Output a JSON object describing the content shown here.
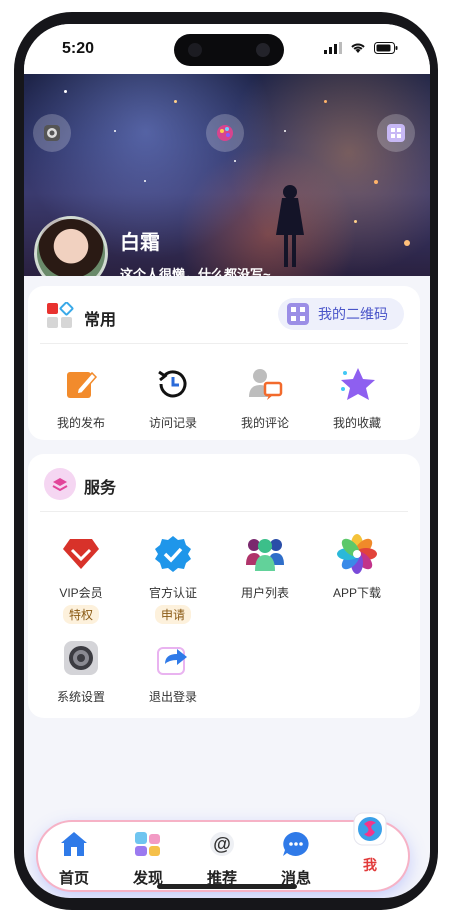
{
  "status_bar": {
    "time": "5:20"
  },
  "profile": {
    "name": "白霜",
    "bio": "这个人很懒，什么都没写~"
  },
  "common": {
    "title": "常用",
    "qr_label": "我的二维码",
    "items": [
      {
        "label": "我的发布",
        "icon": "edit-icon"
      },
      {
        "label": "访问记录",
        "icon": "history-icon"
      },
      {
        "label": "我的评论",
        "icon": "comment-icon"
      },
      {
        "label": "我的收藏",
        "icon": "star-icon"
      }
    ]
  },
  "service": {
    "title": "服务",
    "items": [
      {
        "label": "VIP会员",
        "tag": "特权",
        "icon": "vip-icon"
      },
      {
        "label": "官方认证",
        "tag": "申请",
        "icon": "verified-icon"
      },
      {
        "label": "用户列表",
        "icon": "users-icon"
      },
      {
        "label": "APP下载",
        "icon": "app-download-icon"
      },
      {
        "label": "系统设置",
        "icon": "settings-icon"
      },
      {
        "label": "退出登录",
        "icon": "logout-icon"
      }
    ]
  },
  "tabs": [
    {
      "label": "首页",
      "icon": "home-icon"
    },
    {
      "label": "发现",
      "icon": "discover-icon"
    },
    {
      "label": "推荐",
      "icon": "at-icon"
    },
    {
      "label": "消息",
      "icon": "message-icon"
    },
    {
      "label": "我",
      "icon": "profile-logo-icon",
      "active": true
    }
  ]
}
